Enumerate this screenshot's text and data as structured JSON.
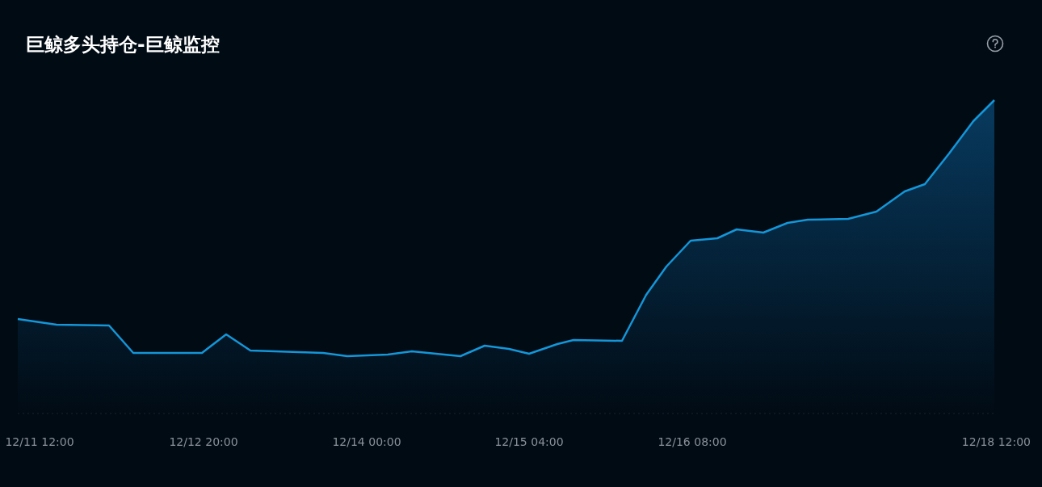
{
  "title": "巨鲸多头持仓-巨鲸监控",
  "chart": {
    "x_labels": [
      "12/11 12:00",
      "12/12 20:00",
      "12/14 00:00",
      "12/15 04:00",
      "12/16 08:00",
      "12/18 12:00"
    ]
  }
}
